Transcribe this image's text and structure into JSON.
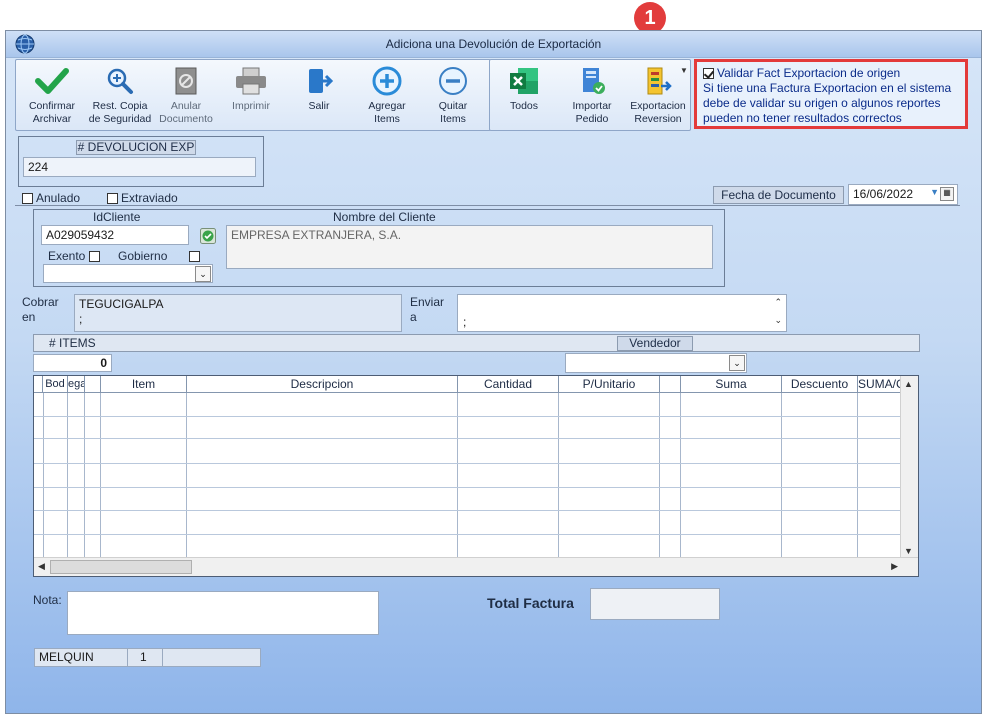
{
  "window": {
    "title": "Adiciona una Devolución de Exportación"
  },
  "annotation": {
    "badge": "1"
  },
  "toolbar1": [
    {
      "id": "confirm",
      "label1": "Confirmar",
      "label2": "Archivar",
      "icon": "checkmark-icon"
    },
    {
      "id": "restore",
      "label1": "Rest. Copia",
      "label2": "de Seguridad",
      "icon": "zoom-add-icon"
    },
    {
      "id": "void",
      "label1": "Anular",
      "label2": "Documento",
      "icon": "void-document-icon"
    },
    {
      "id": "print",
      "label1": "Imprimir",
      "label2": "",
      "icon": "printer-icon"
    },
    {
      "id": "exit",
      "label1": "Salir",
      "label2": "",
      "icon": "exit-door-icon"
    },
    {
      "id": "add",
      "label1": "Agregar",
      "label2": "Items",
      "icon": "plus-circle-icon"
    },
    {
      "id": "remove",
      "label1": "Quitar",
      "label2": "Items",
      "icon": "minus-circle-icon"
    }
  ],
  "toolbar2": [
    {
      "id": "all",
      "label1": "Todos",
      "label2": "",
      "icon": "excel-icon"
    },
    {
      "id": "import",
      "label1": "Importar",
      "label2": "Pedido",
      "icon": "import-order-icon"
    },
    {
      "id": "export",
      "label1": "Exportacion",
      "label2": "Reversion",
      "icon": "export-reversion-icon"
    }
  ],
  "callout": {
    "checkbox_label": "Validar Fact Exportacion de origen",
    "checked": true,
    "line1": "Si tiene una Factura Exportacion en el sistema",
    "line2": "debe de validar su origen o algunos reportes",
    "line3": "pueden no tener resultados correctos"
  },
  "doc": {
    "header": "# DEVOLUCION EXP",
    "value": "224"
  },
  "flags": {
    "anulado": "Anulado",
    "extraviado": "Extraviado"
  },
  "date": {
    "label": "Fecha de  Documento",
    "value": "16/06/2022"
  },
  "client": {
    "id_header": "IdCliente",
    "id_value": "A029059432",
    "name_header": "Nombre del Cliente",
    "name_value": "EMPRESA EXTRANJERA, S.A.",
    "exento": "Exento",
    "gobierno": "Gobierno"
  },
  "cobrar": {
    "label1": "Cobrar",
    "label2": "en",
    "line1": "TEGUCIGALPA",
    "line2": ";"
  },
  "enviar": {
    "label1": "Enviar",
    "label2": "a",
    "value": ";"
  },
  "items": {
    "label": "# ITEMS",
    "count": "0",
    "vendedor": "Vendedor"
  },
  "grid": {
    "columns": [
      "Bodega",
      "Item",
      "Descripcion",
      "Cantidad",
      "P/Unitario",
      "Suma",
      "Descuento",
      "SUMA/C"
    ]
  },
  "footer": {
    "nota_label": "Nota:",
    "total_label": "Total Factura",
    "user": "MELQUIN",
    "num": "1"
  }
}
